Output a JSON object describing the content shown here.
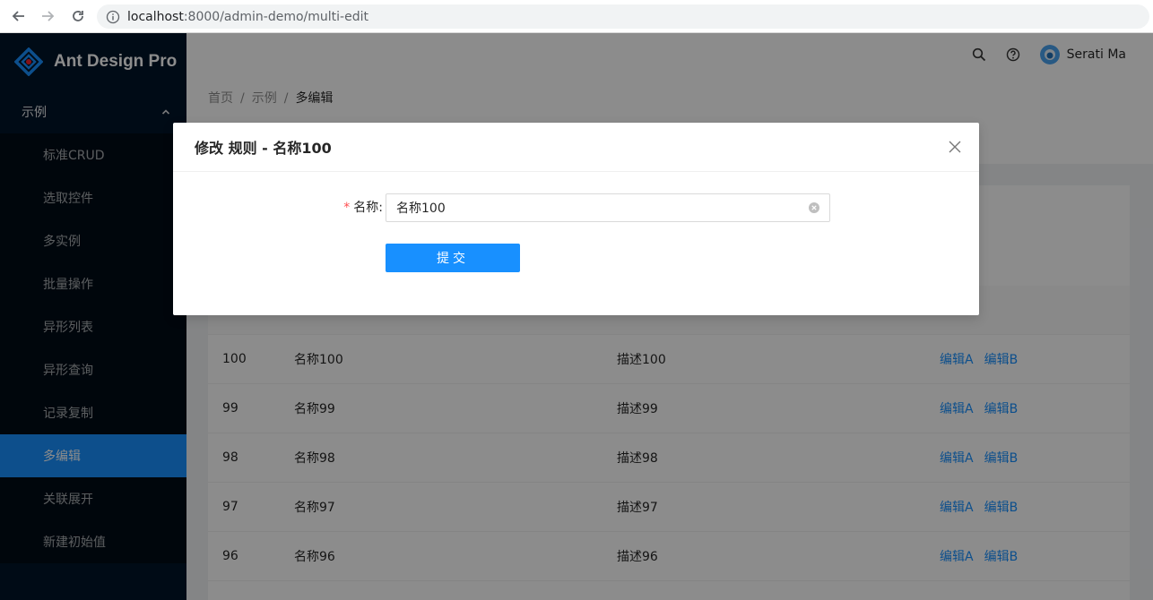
{
  "browser": {
    "url_host": "localhost",
    "url_rest": ":8000/admin-demo/multi-edit"
  },
  "sidebar": {
    "logo_title": "Ant Design Pro",
    "group_label": "示例",
    "items": [
      {
        "label": "标准CRUD"
      },
      {
        "label": "选取控件"
      },
      {
        "label": "多实例"
      },
      {
        "label": "批量操作"
      },
      {
        "label": "异形列表"
      },
      {
        "label": "异形查询"
      },
      {
        "label": "记录复制"
      },
      {
        "label": "多编辑",
        "active": true
      },
      {
        "label": "关联展开"
      },
      {
        "label": "新建初始值"
      }
    ]
  },
  "header": {
    "user_name": "Serati Ma",
    "icons": [
      "search-icon",
      "question-icon",
      "avatar"
    ]
  },
  "breadcrumb": [
    "首页",
    "示例",
    "多编辑"
  ],
  "table": {
    "rows": [
      {
        "id": "100",
        "name": "名称100",
        "desc": "描述100",
        "edit_a": "编辑A",
        "edit_b": "编辑B"
      },
      {
        "id": "99",
        "name": "名称99",
        "desc": "描述99",
        "edit_a": "编辑A",
        "edit_b": "编辑B"
      },
      {
        "id": "98",
        "name": "名称98",
        "desc": "描述98",
        "edit_a": "编辑A",
        "edit_b": "编辑B"
      },
      {
        "id": "97",
        "name": "名称97",
        "desc": "描述97",
        "edit_a": "编辑A",
        "edit_b": "编辑B"
      },
      {
        "id": "96",
        "name": "名称96",
        "desc": "描述96",
        "edit_a": "编辑A",
        "edit_b": "编辑B"
      }
    ]
  },
  "modal": {
    "title": "修改 规则 - 名称100",
    "field_label": "名称:",
    "field_value": "名称100",
    "submit_label": "提交"
  },
  "colors": {
    "primary": "#1890ff",
    "sidebar_bg": "#001529",
    "required": "#ff4d4f"
  }
}
